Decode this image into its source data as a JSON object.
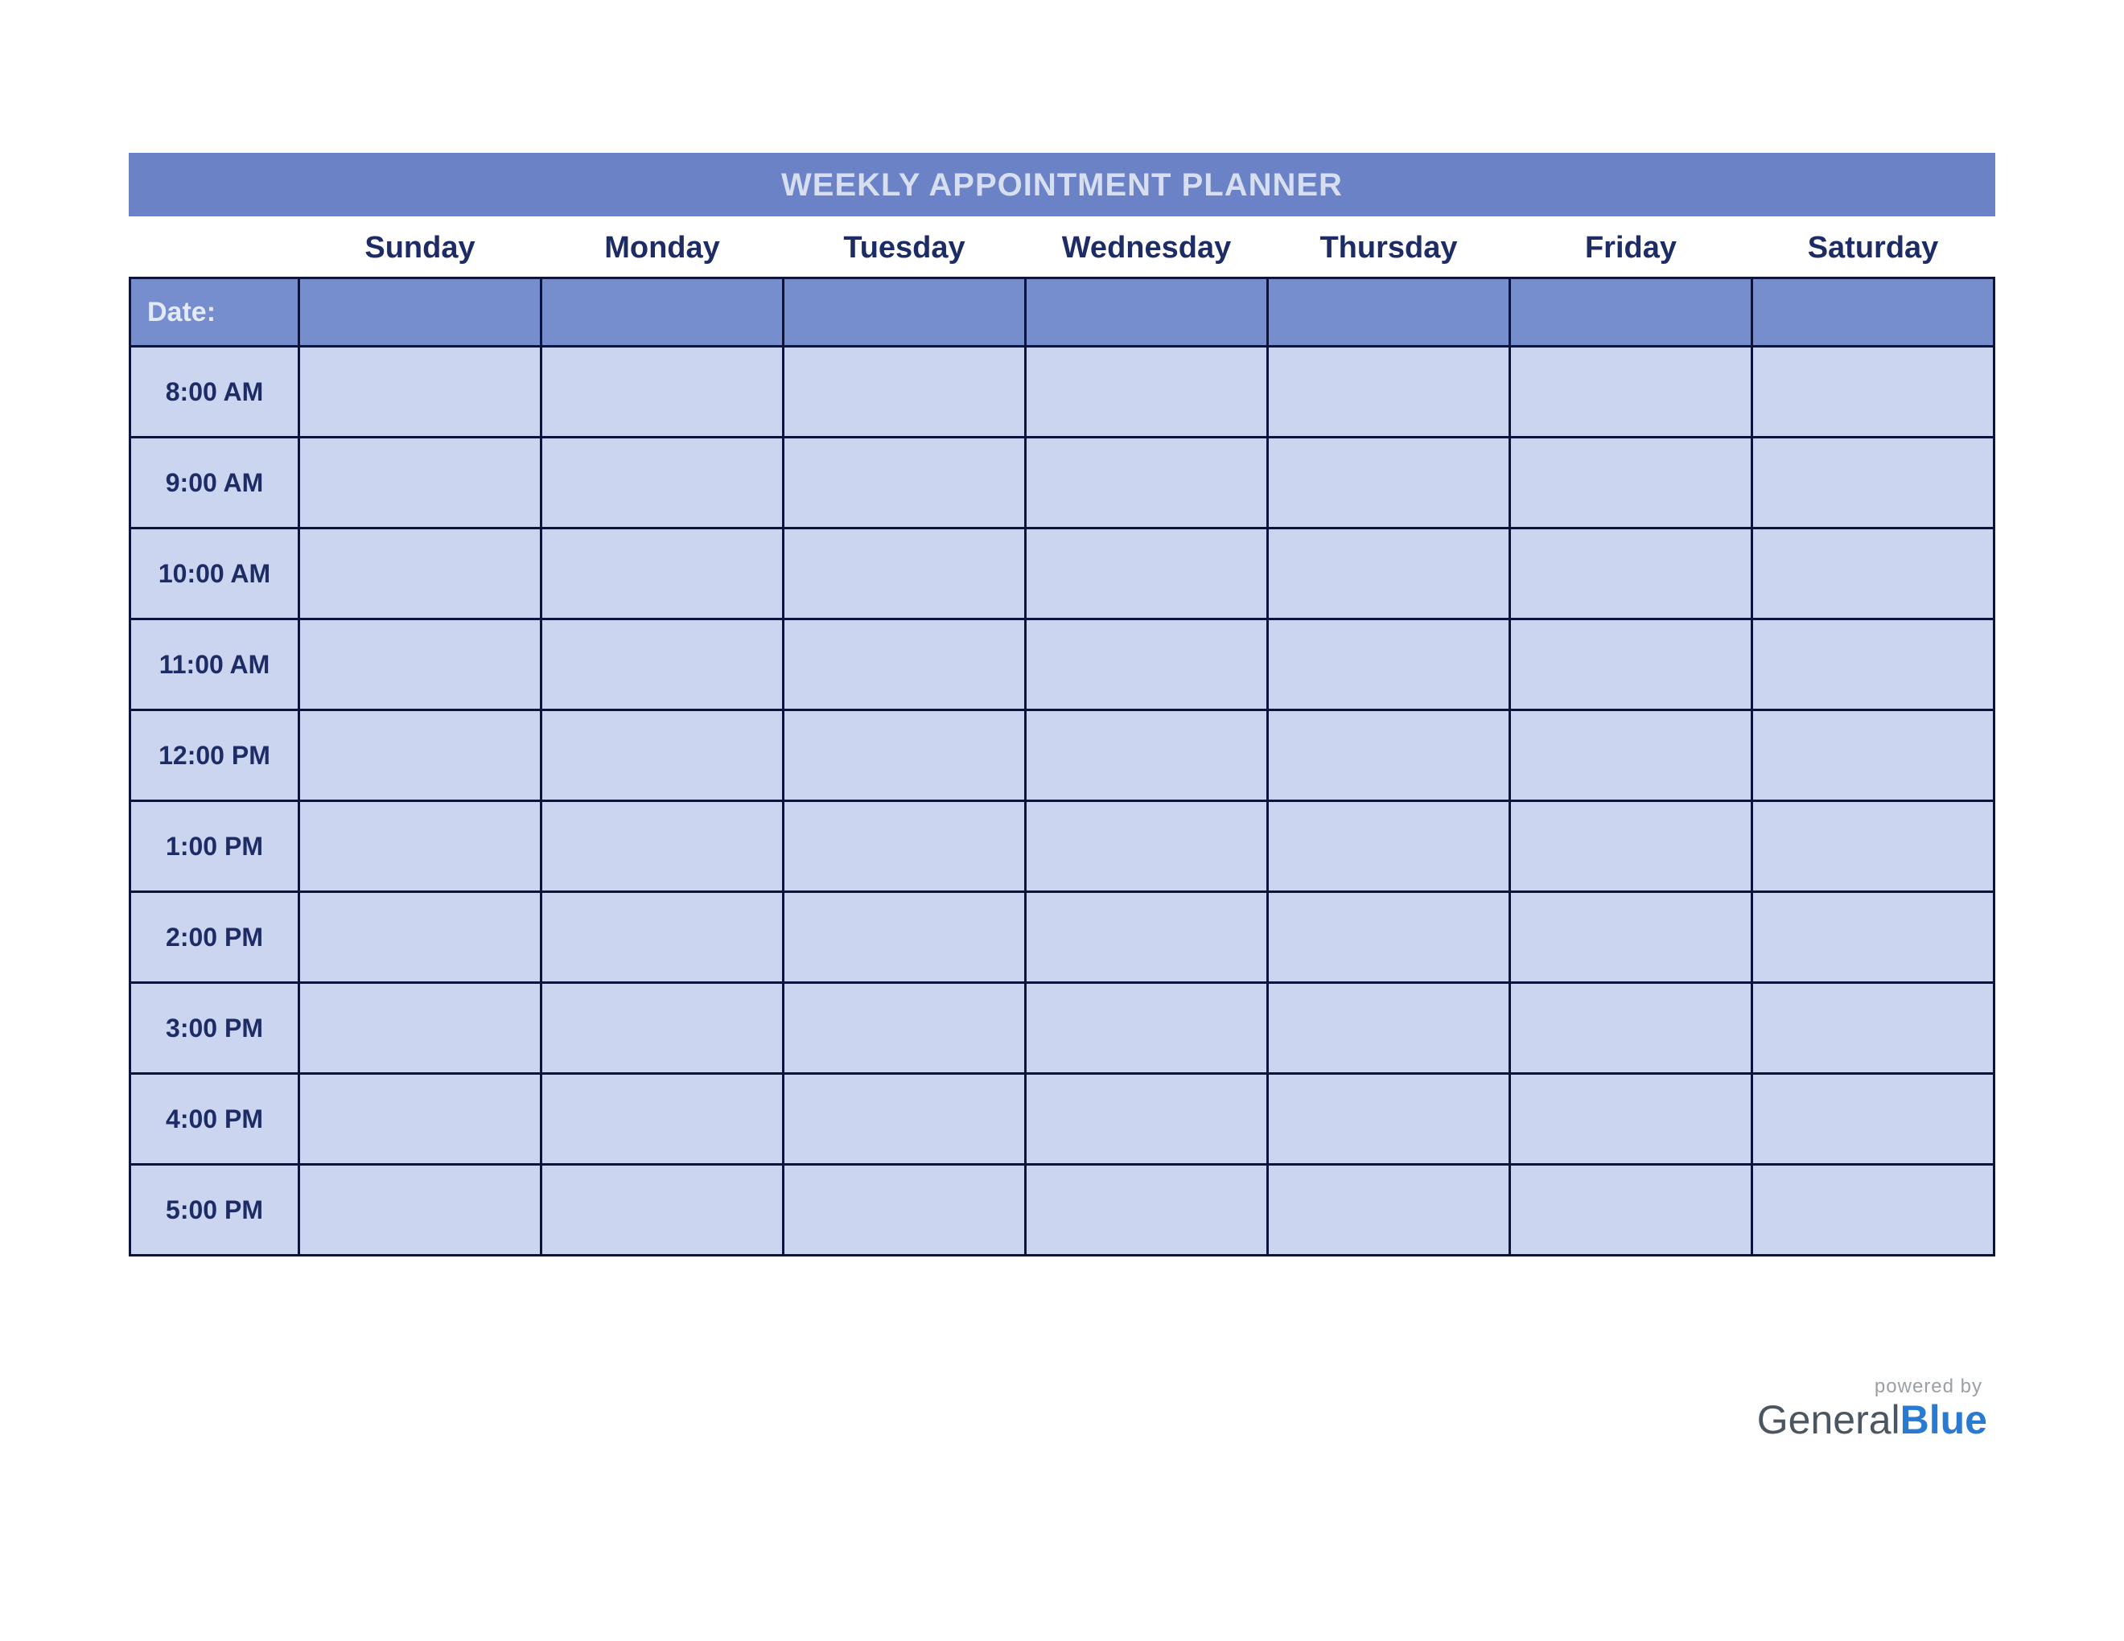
{
  "title": "WEEKLY APPOINTMENT PLANNER",
  "days": [
    "Sunday",
    "Monday",
    "Tuesday",
    "Wednesday",
    "Thursday",
    "Friday",
    "Saturday"
  ],
  "date_label": "Date:",
  "dates": [
    "",
    "",
    "",
    "",
    "",
    "",
    ""
  ],
  "slots": [
    {
      "time": "8:00 AM",
      "cells": [
        "",
        "",
        "",
        "",
        "",
        "",
        ""
      ]
    },
    {
      "time": "9:00 AM",
      "cells": [
        "",
        "",
        "",
        "",
        "",
        "",
        ""
      ]
    },
    {
      "time": "10:00 AM",
      "cells": [
        "",
        "",
        "",
        "",
        "",
        "",
        ""
      ]
    },
    {
      "time": "11:00 AM",
      "cells": [
        "",
        "",
        "",
        "",
        "",
        "",
        ""
      ]
    },
    {
      "time": "12:00 PM",
      "cells": [
        "",
        "",
        "",
        "",
        "",
        "",
        ""
      ]
    },
    {
      "time": "1:00 PM",
      "cells": [
        "",
        "",
        "",
        "",
        "",
        "",
        ""
      ]
    },
    {
      "time": "2:00 PM",
      "cells": [
        "",
        "",
        "",
        "",
        "",
        "",
        ""
      ]
    },
    {
      "time": "3:00 PM",
      "cells": [
        "",
        "",
        "",
        "",
        "",
        "",
        ""
      ]
    },
    {
      "time": "4:00 PM",
      "cells": [
        "",
        "",
        "",
        "",
        "",
        "",
        ""
      ]
    },
    {
      "time": "5:00 PM",
      "cells": [
        "",
        "",
        "",
        "",
        "",
        "",
        ""
      ]
    }
  ],
  "footer": {
    "powered": "powered by",
    "brand_part1": "General",
    "brand_part2": "Blue"
  }
}
